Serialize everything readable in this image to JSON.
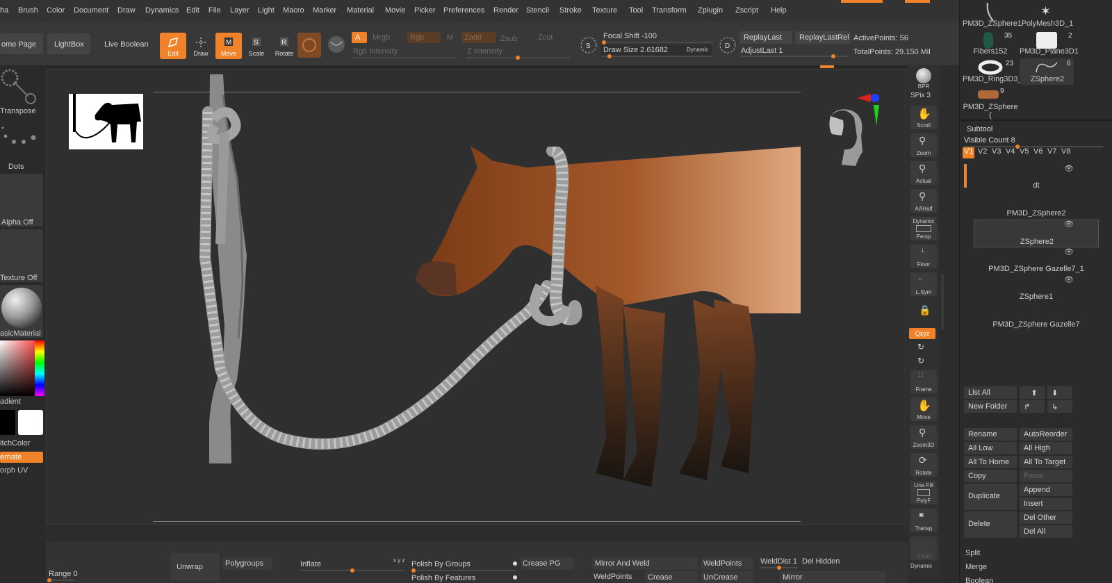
{
  "menu": [
    "ha",
    "Brush",
    "Color",
    "Document",
    "Draw",
    "Dynamics",
    "Edit",
    "File",
    "Layer",
    "Light",
    "Macro",
    "Marker",
    "Material",
    "Movie",
    "Picker",
    "Preferences",
    "Render",
    "Stencil",
    "Stroke",
    "Texture",
    "Tool",
    "Transform",
    "Zplugin",
    "Zscript",
    "Help"
  ],
  "toolbar": {
    "home_page": "ome Page",
    "lightbox": "LightBox",
    "live_boolean": "Live Boolean",
    "edit": "Edit",
    "draw": "Draw",
    "move": "Move",
    "scale": "Scale",
    "rotate": "Rotate",
    "a": "A",
    "mrgb": "Mrgb",
    "rgb": "Rgb",
    "m": "M",
    "zadd": "Zadd",
    "zsub": "Zsub",
    "zcut": "Zcut",
    "rgb_intensity": "Rgb Intensity",
    "z_intensity": "Z Intensity",
    "focal_shift": "Focal Shift -100",
    "draw_size": "Draw Size 2.61682",
    "dynamic": "Dynamic",
    "replay_last": "ReplayLast",
    "replay_last_rel": "ReplayLastRel",
    "adjust_last": "AdjustLast 1",
    "active_points": "ActivePoints: 56",
    "total_points": "TotalPoints: 29.150 Mil"
  },
  "left": {
    "transpose": "Transpose",
    "dots": "Dots",
    "alpha_off": "Alpha Off",
    "texture_off": "Texture Off",
    "material": "asicMaterial",
    "gradient": "adient",
    "switch_color": "itchColor",
    "alternate": "ernate",
    "morph_uv": "orph UV"
  },
  "right": {
    "bpr": "BPR",
    "spix": "SPix 3",
    "scroll": "Scroll",
    "zoom": "Zoom",
    "actual": "Actual",
    "aahalf": "AAHalf",
    "persp_top": "Dynamic",
    "persp": "Persp",
    "floor": "Floor",
    "lsym": "L.Sym",
    "xyz": "Qxyz",
    "frame": "Frame",
    "move": "Move",
    "zoom3d": "Zoom3D",
    "rotate": "Rotate",
    "polyf_top": "Line Fill",
    "polyf": "PolyF",
    "transp": "Transp",
    "ghost": "Ghost",
    "dynamic2": "Dynamic"
  },
  "tray": {
    "thumbs": [
      {
        "name": "PM3D_ZSphere1",
        "count": ""
      },
      {
        "name": "PolyMesh3D_1",
        "count": ""
      },
      {
        "name": "Fibers152",
        "count": "35"
      },
      {
        "name": "PM3D_Plane3D1",
        "count": "2"
      },
      {
        "name": "PM3D_Ring3D3_",
        "count": "23"
      },
      {
        "name": "ZSphere2",
        "count": "6"
      },
      {
        "name": "PM3D_ZSphere (",
        "count": "9"
      }
    ],
    "subtool_title": "Subtool",
    "visible_count": "Visible Count 8",
    "versions": [
      "V1",
      "V2",
      "V3",
      "V4",
      "V5",
      "V6",
      "V7",
      "V8"
    ],
    "subtools": [
      "dt",
      "PM3D_ZSphere2",
      "ZSphere2",
      "PM3D_ZSphere Gazelle7_1",
      "ZSphere1",
      "PM3D_ZSphere Gazelle7"
    ],
    "list_all": "List All",
    "new_folder": "New Folder",
    "rename": "Rename",
    "auto_reorder": "AutoReorder",
    "all_low": "All Low",
    "all_high": "All High",
    "all_to_home": "All To Home",
    "all_to_target": "All To Target",
    "copy": "Copy",
    "paste": "Paste",
    "duplicate": "Duplicate",
    "append": "Append",
    "insert": "Insert",
    "delete": "Delete",
    "del_other": "Del Other",
    "del_all": "Del All",
    "split": "Split",
    "merge": "Merge",
    "boolean": "Boolean"
  },
  "bottom": {
    "range": "Range 0",
    "unwrap": "Unwrap",
    "polygroups": "Polygroups",
    "inflate": "Inflate",
    "xyz": "x y z",
    "polish_groups": "Polish By Groups",
    "polish_features": "Polish By Features",
    "crease_pg": "Crease PG",
    "mirror_weld": "Mirror And Weld",
    "weld_points": "WeldPoints",
    "weld_dist": "WeldDist 1",
    "del_hidden": "Del Hidden",
    "weld_points2": "WeldPoints",
    "crease": "Crease",
    "uncrease": "UnCrease",
    "mirror": "Mirror"
  },
  "colors": {
    "accent": "#f0822a",
    "bg": "#2c2c2c"
  }
}
